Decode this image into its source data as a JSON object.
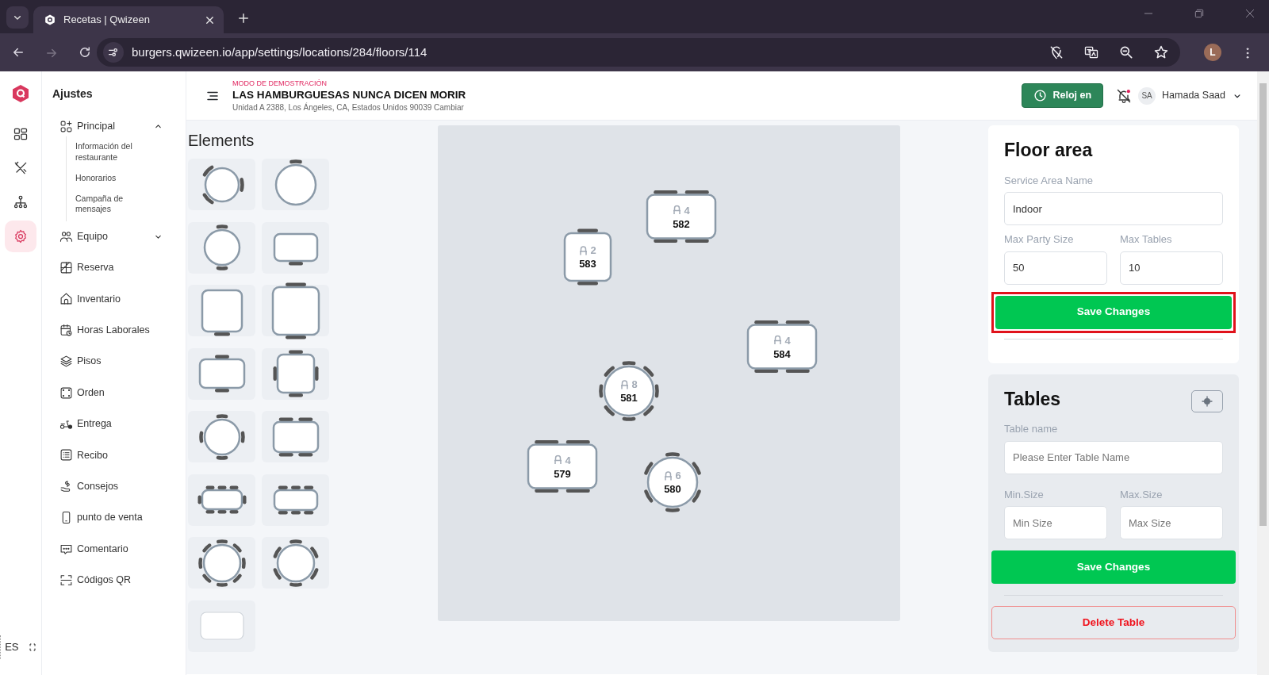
{
  "browser": {
    "tab_title": "Recetas | Qwizeen",
    "url": "burgers.qwizeen.io/app/settings/locations/284/floors/114",
    "profile_initial": "L"
  },
  "rail": [
    {
      "selected": false
    },
    {
      "selected": false
    },
    {
      "selected": false
    },
    {
      "selected": true
    }
  ],
  "sidebar": {
    "title": "Ajustes",
    "language": "ES",
    "items": [
      {
        "label": "Principal",
        "expanded": true,
        "children": [
          {
            "label": "Información del restaurante"
          },
          {
            "label": "Honorarios"
          },
          {
            "label": "Campaña de mensajes"
          }
        ]
      },
      {
        "label": "Equipo",
        "expanded": false
      },
      {
        "label": "Reserva"
      },
      {
        "label": "Inventario"
      },
      {
        "label": "Horas Laborales"
      },
      {
        "label": "Pisos"
      },
      {
        "label": "Orden"
      },
      {
        "label": "Entrega"
      },
      {
        "label": "Recibo"
      },
      {
        "label": "Consejos"
      },
      {
        "label": "punto de venta"
      },
      {
        "label": "Comentario"
      },
      {
        "label": "Códigos QR"
      }
    ]
  },
  "header": {
    "demo_label": "MODO DE DEMOSTRACIÓN",
    "restaurant": "LAS HAMBURGUESAS NUNCA DICEN MORIR",
    "address": "Unidad A 2388, Los Ángeles, CA, Estados Unidos 90039",
    "change_link": "Cambiar",
    "clock_button": "Reloj en",
    "user_initials": "SA",
    "user_name": "Hamada Saad"
  },
  "elements": {
    "title": "Elements",
    "items": [
      {
        "kind": "round-3"
      },
      {
        "kind": "round-1"
      },
      {
        "kind": "round-2"
      },
      {
        "kind": "wide-1"
      },
      {
        "kind": "square-1"
      },
      {
        "kind": "square-2"
      },
      {
        "kind": "wide-2"
      },
      {
        "kind": "square-4"
      },
      {
        "kind": "round-4"
      },
      {
        "kind": "wide-4"
      },
      {
        "kind": "long-8"
      },
      {
        "kind": "long-6"
      },
      {
        "kind": "round-8"
      },
      {
        "kind": "round-6"
      },
      {
        "kind": "plain"
      }
    ]
  },
  "floor_tables": [
    {
      "kind": "rect-4",
      "seats": "4",
      "number": "582"
    },
    {
      "kind": "square-2",
      "seats": "2",
      "number": "583"
    },
    {
      "kind": "rect-4",
      "seats": "4",
      "number": "584"
    },
    {
      "kind": "round-8",
      "seats": "8",
      "number": "581"
    },
    {
      "kind": "rect-4",
      "seats": "4",
      "number": "579"
    },
    {
      "kind": "round-6",
      "seats": "6",
      "number": "580"
    }
  ],
  "floor_area": {
    "title": "Floor area",
    "name_label": "Service Area Name",
    "name_value": "Indoor",
    "party_label": "Max Party Size",
    "party_value": "50",
    "tables_label": "Max Tables",
    "tables_value": "10",
    "save_button": "Save Changes",
    "highlighted": true
  },
  "tables_form": {
    "title": "Tables",
    "name_label": "Table name",
    "name_placeholder": "Please Enter Table Name",
    "min_label": "Min.Size",
    "min_placeholder": "Min Size",
    "max_label": "Max.Size",
    "max_placeholder": "Max Size",
    "save_button": "Save Changes",
    "delete_button": "Delete Table"
  }
}
